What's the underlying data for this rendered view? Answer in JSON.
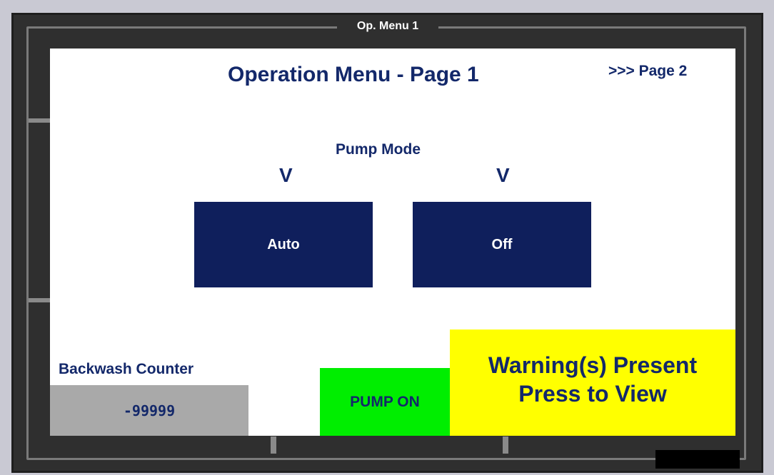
{
  "window": {
    "title": "Op. Menu 1"
  },
  "screen": {
    "heading": "Operation Menu - Page 1",
    "next_page_link": ">>> Page 2"
  },
  "pump_mode": {
    "label": "Pump Mode",
    "indicators": [
      "V",
      "V"
    ],
    "buttons": [
      {
        "label": "Auto"
      },
      {
        "label": "Off"
      }
    ]
  },
  "backwash": {
    "label": "Backwash Counter",
    "value": "-99999"
  },
  "pump_status": {
    "label": "PUMP ON",
    "color": "#00ee00"
  },
  "warning": {
    "line1": "Warning(s) Present",
    "line2": "Press to View",
    "color": "#ffff00"
  },
  "colors": {
    "text_navy": "#13286a",
    "button_navy": "#0f1f5c",
    "counter_gray": "#a9a9a9",
    "bezel": "#2f2f2f"
  }
}
